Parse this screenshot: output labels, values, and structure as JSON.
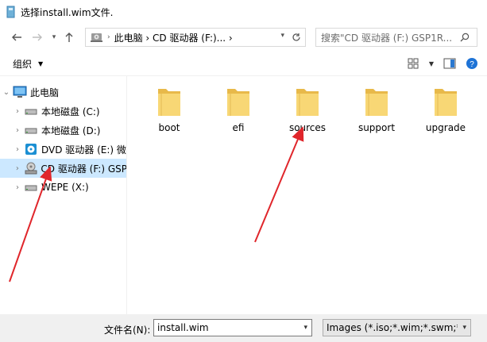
{
  "window": {
    "title": "选择install.wim文件."
  },
  "navigation": {
    "back_icon": "back-arrow-icon",
    "forward_icon": "forward-arrow-icon",
    "recent_icon": "chevron-down-icon",
    "up_icon": "up-arrow-icon",
    "address": {
      "path": "此电脑  ›  CD 驱动器 (F:)...  ›",
      "icon": "computer-icon"
    },
    "search": {
      "placeholder": "搜索\"CD 驱动器 (F:) GSP1R..."
    }
  },
  "toolbar": {
    "organize_label": "组织",
    "view_icon": "view-grid-icon",
    "preview_icon": "preview-pane-icon"
  },
  "tree": {
    "items": [
      {
        "label": "此电脑",
        "icon": "monitor-icon",
        "expanded": true,
        "selected": false
      },
      {
        "label": "本地磁盘 (C:)",
        "icon": "drive-icon",
        "expanded": false,
        "selected": false
      },
      {
        "label": "本地磁盘 (D:)",
        "icon": "drive-icon",
        "expanded": false,
        "selected": false
      },
      {
        "label": "DVD 驱动器 (E:) 微",
        "icon": "dvd-icon",
        "expanded": false,
        "selected": false
      },
      {
        "label": "CD 驱动器 (F:) GSP",
        "icon": "cd-drive-icon",
        "expanded": false,
        "selected": true
      },
      {
        "label": "WEPE (X:)",
        "icon": "drive-icon",
        "expanded": false,
        "selected": false
      }
    ]
  },
  "files": [
    {
      "name": "boot",
      "icon": "folder-icon"
    },
    {
      "name": "efi",
      "icon": "folder-icon"
    },
    {
      "name": "sources",
      "icon": "folder-icon"
    },
    {
      "name": "support",
      "icon": "folder-icon"
    },
    {
      "name": "upgrade",
      "icon": "folder-icon"
    }
  ],
  "bottom": {
    "filename_label": "文件名(N):",
    "filename_value": "install.wim",
    "filetype_value": "Images (*.iso;*.wim;*.swm;*.e"
  },
  "colors": {
    "selection": "#cce8ff",
    "folder": "#f8d775",
    "arrow": "#e0262b"
  }
}
